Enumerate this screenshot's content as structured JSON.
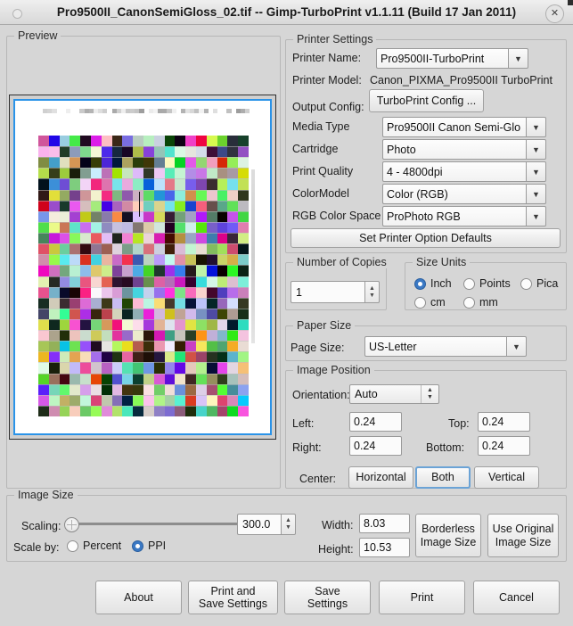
{
  "window": {
    "title": "Pro9500II_CanonSemiGloss_02.tif -- Gimp-TurboPrint v1.1.11 (Build 17 Jan 2011)",
    "close_label": "✕",
    "menu_icon": "window-menu-icon"
  },
  "preview": {
    "frame_label": "Preview",
    "page_border_color": "#2a93e8",
    "page_background": "#ffffff",
    "canvas_background": "#cfcfcf"
  },
  "printer_settings": {
    "frame_label": "Printer Settings",
    "printer_name_label": "Printer Name:",
    "printer_name_value": "Pro9500II-TurboPrint",
    "printer_model_label": "Printer Model:",
    "printer_model_value": "Canon_PIXMA_Pro9500II TurboPrint",
    "output_config_label": "Output Config:",
    "output_config_button": "TurboPrint Config ...",
    "media_type_label": "Media Type",
    "media_type_value": "Pro9500II Canon Semi-Glo",
    "cartridge_label": "Cartridge",
    "cartridge_value": "Photo",
    "print_quality_label": "Print Quality",
    "print_quality_value": "4 - 4800dpi",
    "color_model_label": "ColorModel",
    "color_model_value": "Color (RGB)",
    "rgb_color_space_label": "RGB Color Space",
    "rgb_color_space_value": "ProPhoto RGB",
    "set_defaults_button": "Set Printer Option Defaults",
    "dropdown_arrow": "▼"
  },
  "copies": {
    "frame_label": "Number of Copies",
    "value": "1",
    "up_arrow": "▲",
    "down_arrow": "▼"
  },
  "size_units": {
    "frame_label": "Size Units",
    "options": [
      {
        "label": "Inch",
        "selected": true
      },
      {
        "label": "Points",
        "selected": false
      },
      {
        "label": "Pica",
        "selected": false
      },
      {
        "label": "cm",
        "selected": false
      },
      {
        "label": "mm",
        "selected": false
      }
    ]
  },
  "paper_size": {
    "frame_label": "Paper Size",
    "page_size_label": "Page Size:",
    "page_size_value": "US-Letter"
  },
  "image_position": {
    "frame_label": "Image Position",
    "orientation_label": "Orientation:",
    "orientation_value": "Auto",
    "left_label": "Left:",
    "left_value": "0.24",
    "top_label": "Top:",
    "top_value": "0.24",
    "right_label": "Right:",
    "right_value": "0.24",
    "bottom_label": "Bottom:",
    "bottom_value": "0.24",
    "center_label": "Center:",
    "center_horizontal": "Horizontal",
    "center_both": "Both",
    "center_vertical": "Vertical",
    "center_focused": "Both"
  },
  "image_size": {
    "frame_label": "Image Size",
    "scaling_label": "Scaling:",
    "scaling_value": "300.0",
    "scale_by_label": "Scale by:",
    "scale_by_options": [
      {
        "label": "Percent",
        "selected": false
      },
      {
        "label": "PPI",
        "selected": true
      }
    ],
    "width_label": "Width:",
    "width_value": "8.03",
    "height_label": "Height:",
    "height_value": "10.53",
    "borderless_button": "Borderless\nImage Size",
    "use_original_button": "Use Original\nImage Size"
  },
  "actions": {
    "about": "About",
    "print_and_save": "Print and\nSave Settings",
    "save_settings": "Save\nSettings",
    "print": "Print",
    "cancel": "Cancel"
  },
  "theme": {
    "window_background": "#d6d6d6",
    "accent": "#3b79c4",
    "focus_border": "#6ba3d6",
    "frame_border": "#b7b7b7",
    "text": "#1c1c1c"
  }
}
